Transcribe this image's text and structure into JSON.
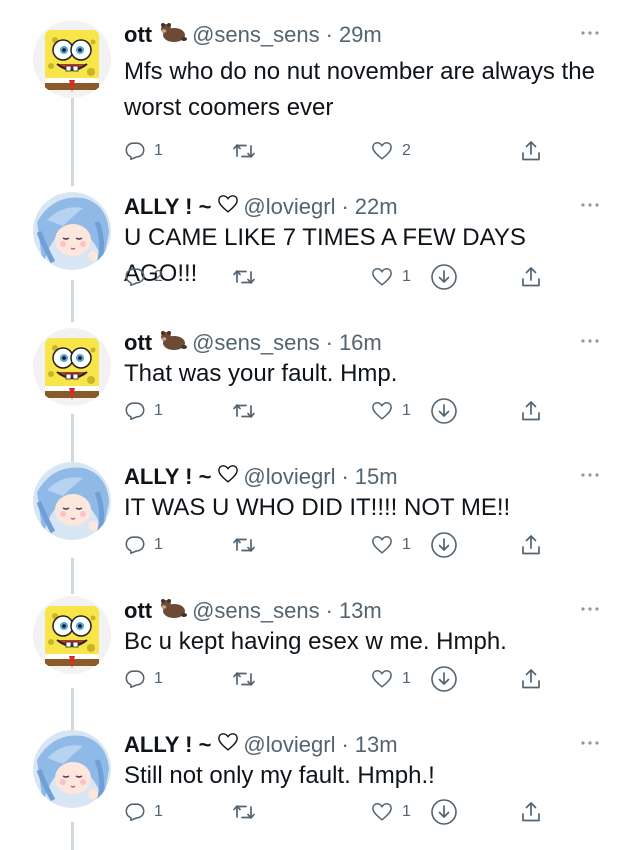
{
  "tweets": [
    {
      "author": "ott",
      "handle": "@sens_sens",
      "time": "29m",
      "avatar": "spongebob",
      "name_emoji": "bear",
      "text": "Mfs who do no nut november are always the worst coomers ever",
      "replies": "1",
      "likes": "2",
      "show_download": false
    },
    {
      "author": "ALLY ! ~",
      "handle": "@loviegrl",
      "time": "22m",
      "avatar": "anime-girl",
      "name_emoji": "heart",
      "text": "U CAME LIKE 7 TIMES A FEW DAYS AGO!!!",
      "replies": "2",
      "likes": "1",
      "show_download": true
    },
    {
      "author": "ott",
      "handle": "@sens_sens",
      "time": "16m",
      "avatar": "spongebob",
      "name_emoji": "bear",
      "text": "That was your fault. Hmp.",
      "replies": "1",
      "likes": "1",
      "show_download": true
    },
    {
      "author": "ALLY ! ~",
      "handle": "@loviegrl",
      "time": "15m",
      "avatar": "anime-girl",
      "name_emoji": "heart",
      "text": "IT WAS U WHO DID IT!!!! NOT ME!!",
      "replies": "1",
      "likes": "1",
      "show_download": true
    },
    {
      "author": "ott",
      "handle": "@sens_sens",
      "time": "13m",
      "avatar": "spongebob",
      "name_emoji": "bear",
      "text": "Bc u kept having esex w me. Hmph.",
      "replies": "1",
      "likes": "1",
      "show_download": true
    },
    {
      "author": "ALLY ! ~",
      "handle": "@loviegrl",
      "time": "13m",
      "avatar": "anime-girl",
      "name_emoji": "heart",
      "text": "Still not only my fault. Hmph.!",
      "replies": "1",
      "likes": "1",
      "show_download": true
    }
  ],
  "separator": "·",
  "colors": {
    "text": "#0f1419",
    "secondary": "#536471",
    "thread_line": "#cfd9de"
  },
  "icons": [
    "reply-icon",
    "retweet-icon",
    "like-icon",
    "download-icon",
    "share-icon",
    "more-icon",
    "heart-emoji-icon",
    "bear-emoji-icon"
  ]
}
